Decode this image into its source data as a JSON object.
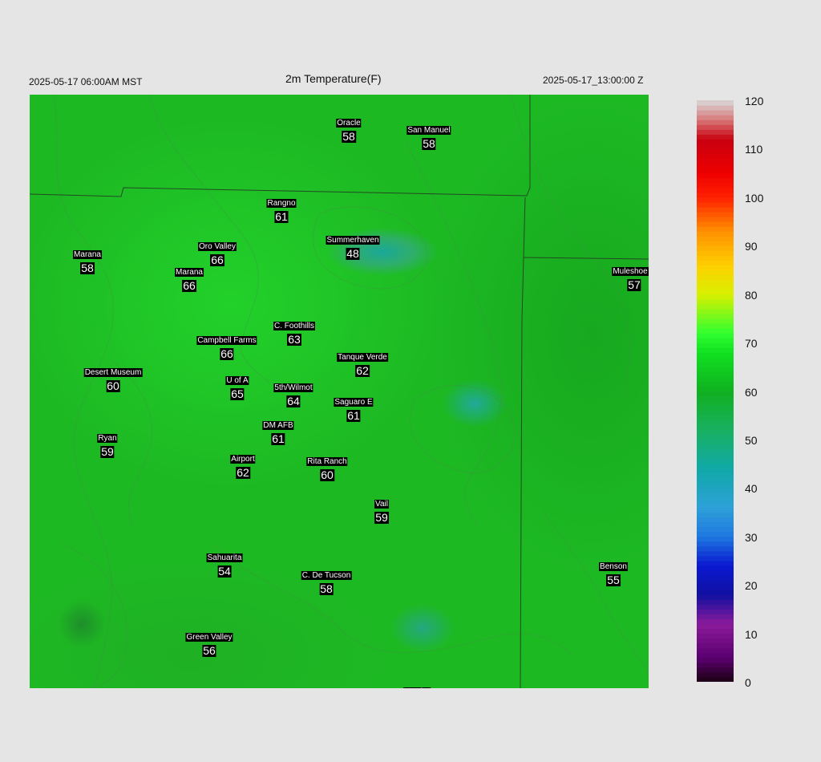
{
  "header": {
    "local_time": "2025-05-17 06:00AM MST",
    "title": "2m Temperature(F)",
    "utc_time": "2025-05-17_13:00:00 Z"
  },
  "stations": [
    {
      "name": "Oracle",
      "temp": "58"
    },
    {
      "name": "San Manuel",
      "temp": "58"
    },
    {
      "name": "Rangno",
      "temp": "61"
    },
    {
      "name": "Summerhaven",
      "temp": "48"
    },
    {
      "name": "Marana",
      "temp": "58"
    },
    {
      "name": "Oro Valley",
      "temp": "66"
    },
    {
      "name": "Marana",
      "temp": "66"
    },
    {
      "name": "Muleshoe R",
      "temp": "57"
    },
    {
      "name": "C. Foothills",
      "temp": "63"
    },
    {
      "name": "Campbell Farms",
      "temp": "66"
    },
    {
      "name": "Tanque Verde",
      "temp": "62"
    },
    {
      "name": "Desert Museum",
      "temp": "60"
    },
    {
      "name": "U of A",
      "temp": "65"
    },
    {
      "name": "5th/Wilmot",
      "temp": "64"
    },
    {
      "name": "Saguaro E",
      "temp": "61"
    },
    {
      "name": "DM AFB",
      "temp": "61"
    },
    {
      "name": "Ryan",
      "temp": "59"
    },
    {
      "name": "Airport",
      "temp": "62"
    },
    {
      "name": "Rita Ranch",
      "temp": "60"
    },
    {
      "name": "Vail",
      "temp": "59"
    },
    {
      "name": "Sahuarita",
      "temp": "54"
    },
    {
      "name": "C. De Tucson",
      "temp": "58"
    },
    {
      "name": "Benson",
      "temp": "55"
    },
    {
      "name": "Green Valley",
      "temp": "56"
    },
    {
      "name": "Empire",
      "temp": ""
    }
  ],
  "colorbar": {
    "ticks": [
      "120",
      "110",
      "100",
      "90",
      "80",
      "70",
      "60",
      "50",
      "40",
      "30",
      "20",
      "10",
      "0"
    ],
    "min": 0,
    "max": 120,
    "stops": [
      {
        "value": 0,
        "color": "#1a0010"
      },
      {
        "value": 5,
        "color": "#5a0070"
      },
      {
        "value": 12,
        "color": "#8a1a9a"
      },
      {
        "value": 18,
        "color": "#1010a0"
      },
      {
        "value": 24,
        "color": "#0a18d0"
      },
      {
        "value": 30,
        "color": "#1e78e0"
      },
      {
        "value": 36,
        "color": "#2ea0d8"
      },
      {
        "value": 44,
        "color": "#10a8a8"
      },
      {
        "value": 52,
        "color": "#18b060"
      },
      {
        "value": 60,
        "color": "#10b020"
      },
      {
        "value": 68,
        "color": "#10e020"
      },
      {
        "value": 72,
        "color": "#30ff30"
      },
      {
        "value": 80,
        "color": "#d8f000"
      },
      {
        "value": 86,
        "color": "#ffd000"
      },
      {
        "value": 93,
        "color": "#ff9000"
      },
      {
        "value": 100,
        "color": "#ff2000"
      },
      {
        "value": 105,
        "color": "#ee0000"
      },
      {
        "value": 112,
        "color": "#c80010"
      },
      {
        "value": 116,
        "color": "#d87878"
      },
      {
        "value": 120,
        "color": "#d8d8d8"
      }
    ]
  }
}
